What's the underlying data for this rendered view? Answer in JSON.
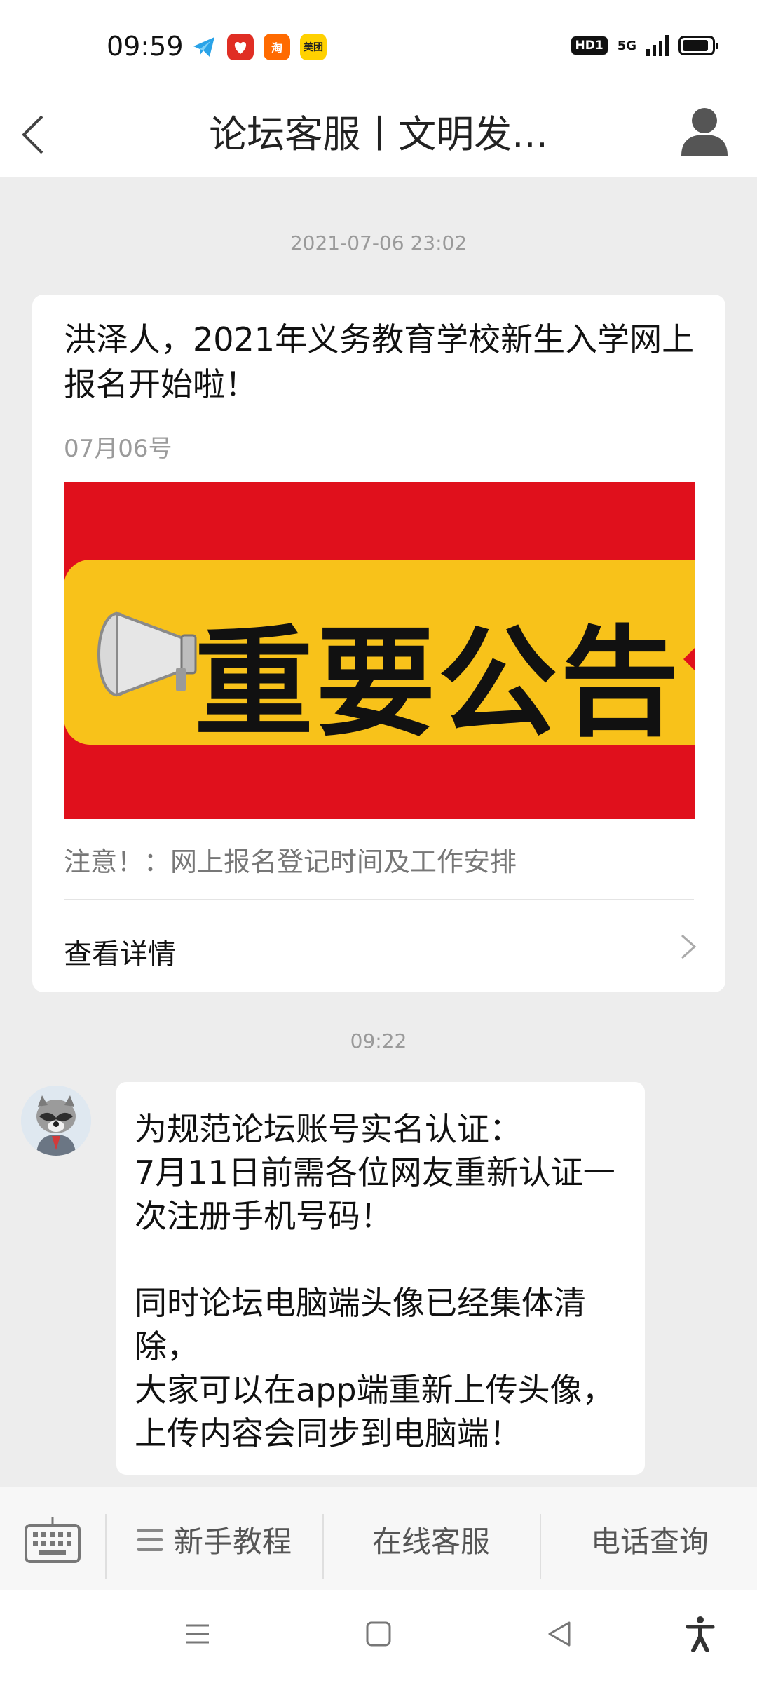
{
  "status_bar": {
    "time": "09:59",
    "app_icons": [
      "telegram-icon",
      "pinduoduo-icon",
      "taobao-icon",
      "meituan-icon"
    ],
    "taobao_badge": "淘",
    "meituan_badge": "美团",
    "hd_label": "HD1",
    "network_label": "5G"
  },
  "nav": {
    "title": "论坛客服丨文明发..."
  },
  "article": {
    "timestamp": "2021-07-06 23:02",
    "title": "洪泽人，2021年义务教育学校新生入学网上报名开始啦！",
    "date": "07月06号",
    "banner_text": "重要公告！",
    "summary": "注意！：网上报名登记时间及工作安排",
    "link_label": "查看详情"
  },
  "message": {
    "timestamp": "09:22",
    "lines": [
      "为规范论坛账号实名认证：",
      "7月11日前需各位网友重新认证一",
      "次注册手机号码！",
      "",
      "同时论坛电脑端头像已经集体清",
      "除，",
      "大家可以在app端重新上传头像，",
      "上传内容会同步到电脑端！"
    ]
  },
  "bottom_menu": {
    "items": [
      "新手教程",
      "在线客服",
      "电话查询"
    ]
  },
  "colors": {
    "banner_red": "#e0101c",
    "banner_yellow": "#f8c21a",
    "page_bg": "#ededed"
  }
}
